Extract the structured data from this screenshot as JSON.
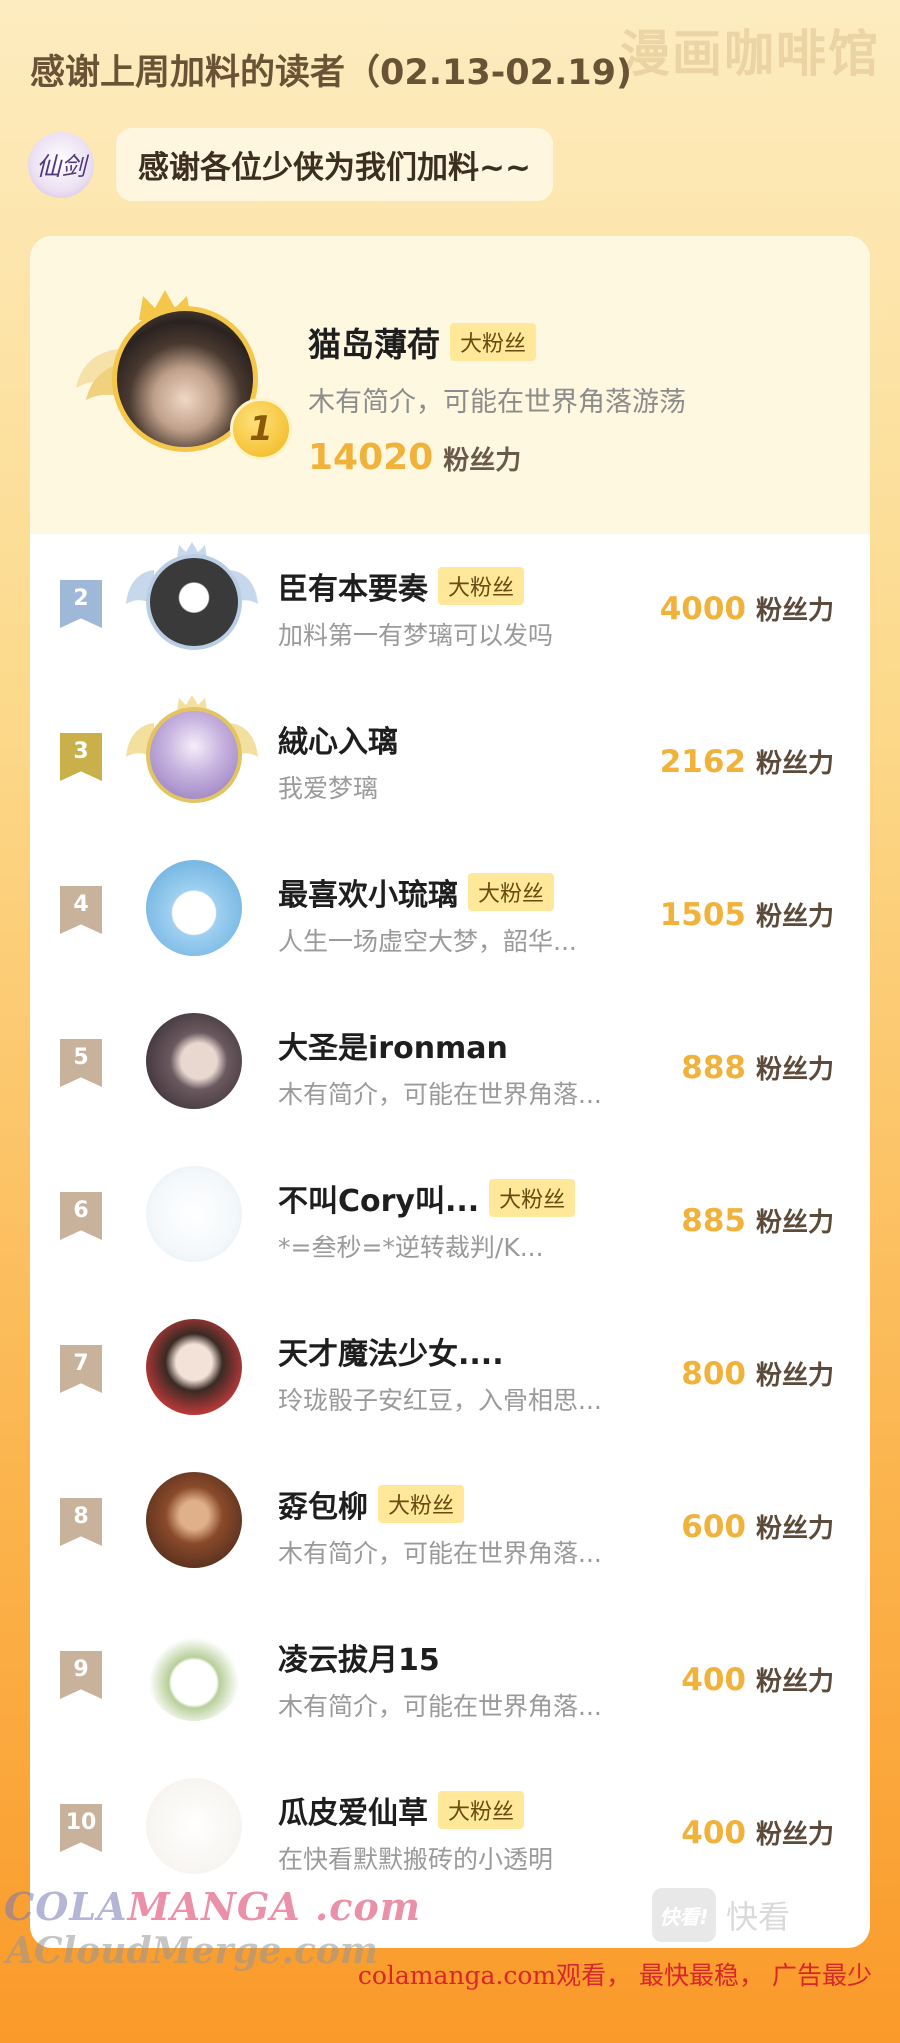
{
  "watermark_top": "漫画咖啡馆",
  "page_title": "感谢上周加料的读者（02.13-02.19)",
  "notice": {
    "logo_text": "仙剑",
    "message": "感谢各位少侠为我们加料~~"
  },
  "power_unit": "粉丝力",
  "fan_badge": "大粉丝",
  "top_reader": {
    "rank": "1",
    "name": "猫岛薄荷",
    "bio": "木有简介，可能在世界角落游荡",
    "power": "14020",
    "has_badge": true
  },
  "readers": [
    {
      "rank": "2",
      "name": "臣有本要奏",
      "bio": "加料第一有梦璃可以发吗",
      "power": "4000",
      "has_badge": true
    },
    {
      "rank": "3",
      "name": "絨心入璃",
      "bio": "我爱梦璃",
      "power": "2162",
      "has_badge": false
    },
    {
      "rank": "4",
      "name": "最喜欢小琉璃",
      "bio": "人生一场虚空大梦，韶华...",
      "power": "1505",
      "has_badge": true
    },
    {
      "rank": "5",
      "name": "大圣是ironman",
      "bio": "木有简介，可能在世界角落...",
      "power": "888",
      "has_badge": false
    },
    {
      "rank": "6",
      "name": "不叫Cory叫...",
      "bio": "*=叁秒=*逆转裁判/K...",
      "power": "885",
      "has_badge": true
    },
    {
      "rank": "7",
      "name": "天才魔法少女....",
      "bio": "玲珑骰子安红豆，入骨相思...",
      "power": "800",
      "has_badge": false
    },
    {
      "rank": "8",
      "name": "孬包柳",
      "bio": "木有简介，可能在世界角落...",
      "power": "600",
      "has_badge": true
    },
    {
      "rank": "9",
      "name": "凌云拔月15",
      "bio": "木有简介，可能在世界角落...",
      "power": "400",
      "has_badge": false
    },
    {
      "rank": "10",
      "name": "瓜皮爱仙草",
      "bio": "在快看默默搬砖的小透明",
      "power": "400",
      "has_badge": true
    }
  ],
  "kuaikan": {
    "box": "快看!",
    "text": "快看"
  },
  "watermarks": {
    "colamanga_a": "COLA",
    "colamanga_b": "MANGA",
    "colamanga_c": " .com",
    "acloud": "ACloudMerge.com",
    "footer": "colamanga.com观看， 最快最稳， 广告最少"
  },
  "colors": {
    "accent": "#f0b23a",
    "badge_bg": "#ffe89a",
    "rank2": "#9fb8d8",
    "rank3": "#c9b04a",
    "rank_other": "#c9b29c"
  }
}
